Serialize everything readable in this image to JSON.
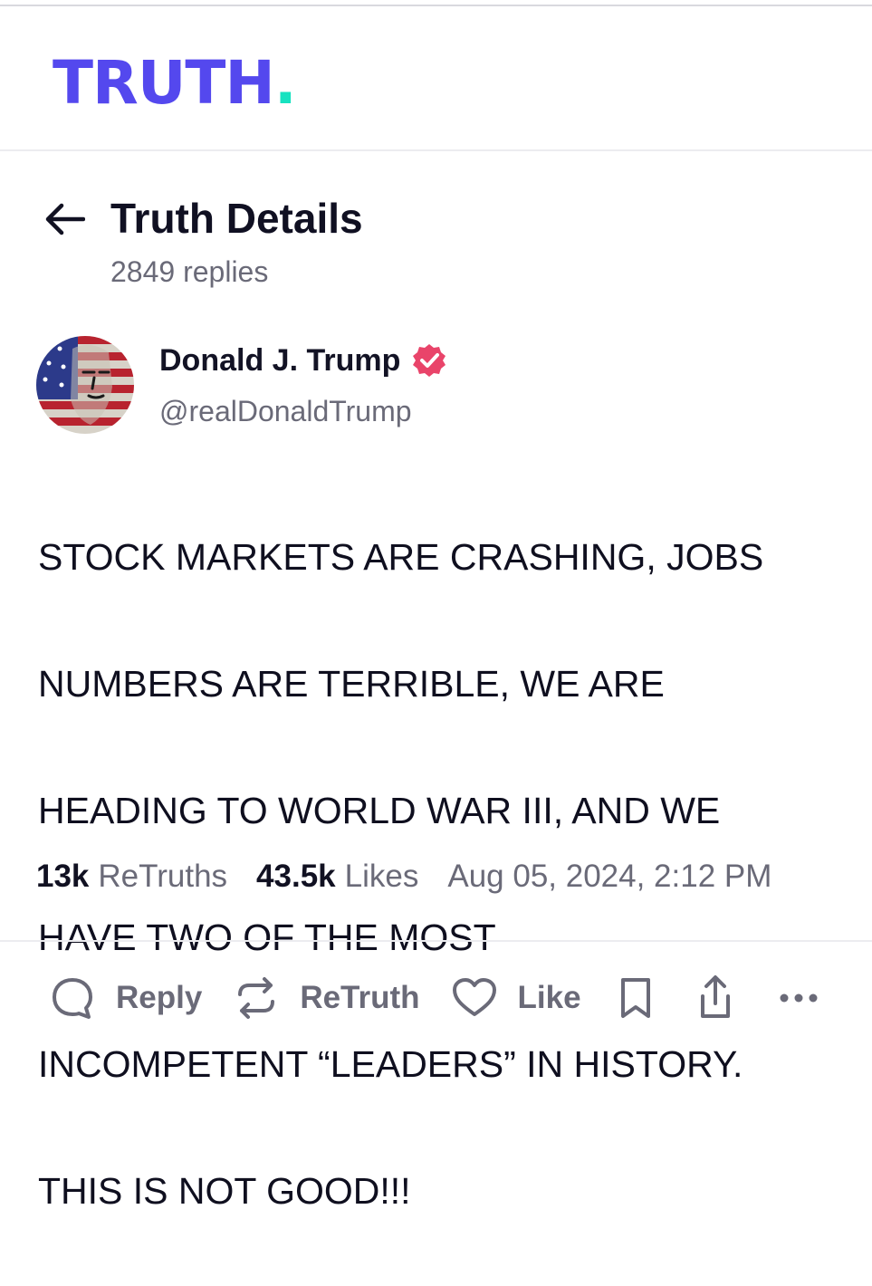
{
  "theme": {
    "brand": "#5448ee",
    "accent": "#17e2c0",
    "verified": "#e9446a"
  },
  "header": {
    "logo_text": "TRUTH",
    "logo_dot": "."
  },
  "page": {
    "title": "Truth Details",
    "reply_count": "2849 replies"
  },
  "author": {
    "display_name": "Donald J. Trump",
    "handle": "@realDonaldTrump",
    "verified": true
  },
  "post": {
    "lines": [
      "STOCK MARKETS ARE CRASHING, JOBS",
      "NUMBERS ARE TERRIBLE, WE ARE",
      "HEADING TO WORLD WAR III, AND WE",
      "HAVE TWO OF THE MOST",
      "INCOMPETENT “LEADERS” IN HISTORY.",
      "THIS IS NOT GOOD!!!"
    ]
  },
  "stats": {
    "retruths_count": "13k",
    "retruths_label": "ReTruths",
    "likes_count": "43.5k",
    "likes_label": "Likes",
    "timestamp": "Aug 05, 2024, 2:12 PM"
  },
  "actions": {
    "reply_label": "Reply",
    "reply_icon": "reply-bubble-icon",
    "retruth_label": "ReTruth",
    "retruth_icon": "repost-icon",
    "like_label": "Like",
    "like_icon": "heart-icon",
    "bookmark_icon": "bookmark-icon",
    "share_icon": "share-icon",
    "more_icon": "more-dots-icon"
  }
}
